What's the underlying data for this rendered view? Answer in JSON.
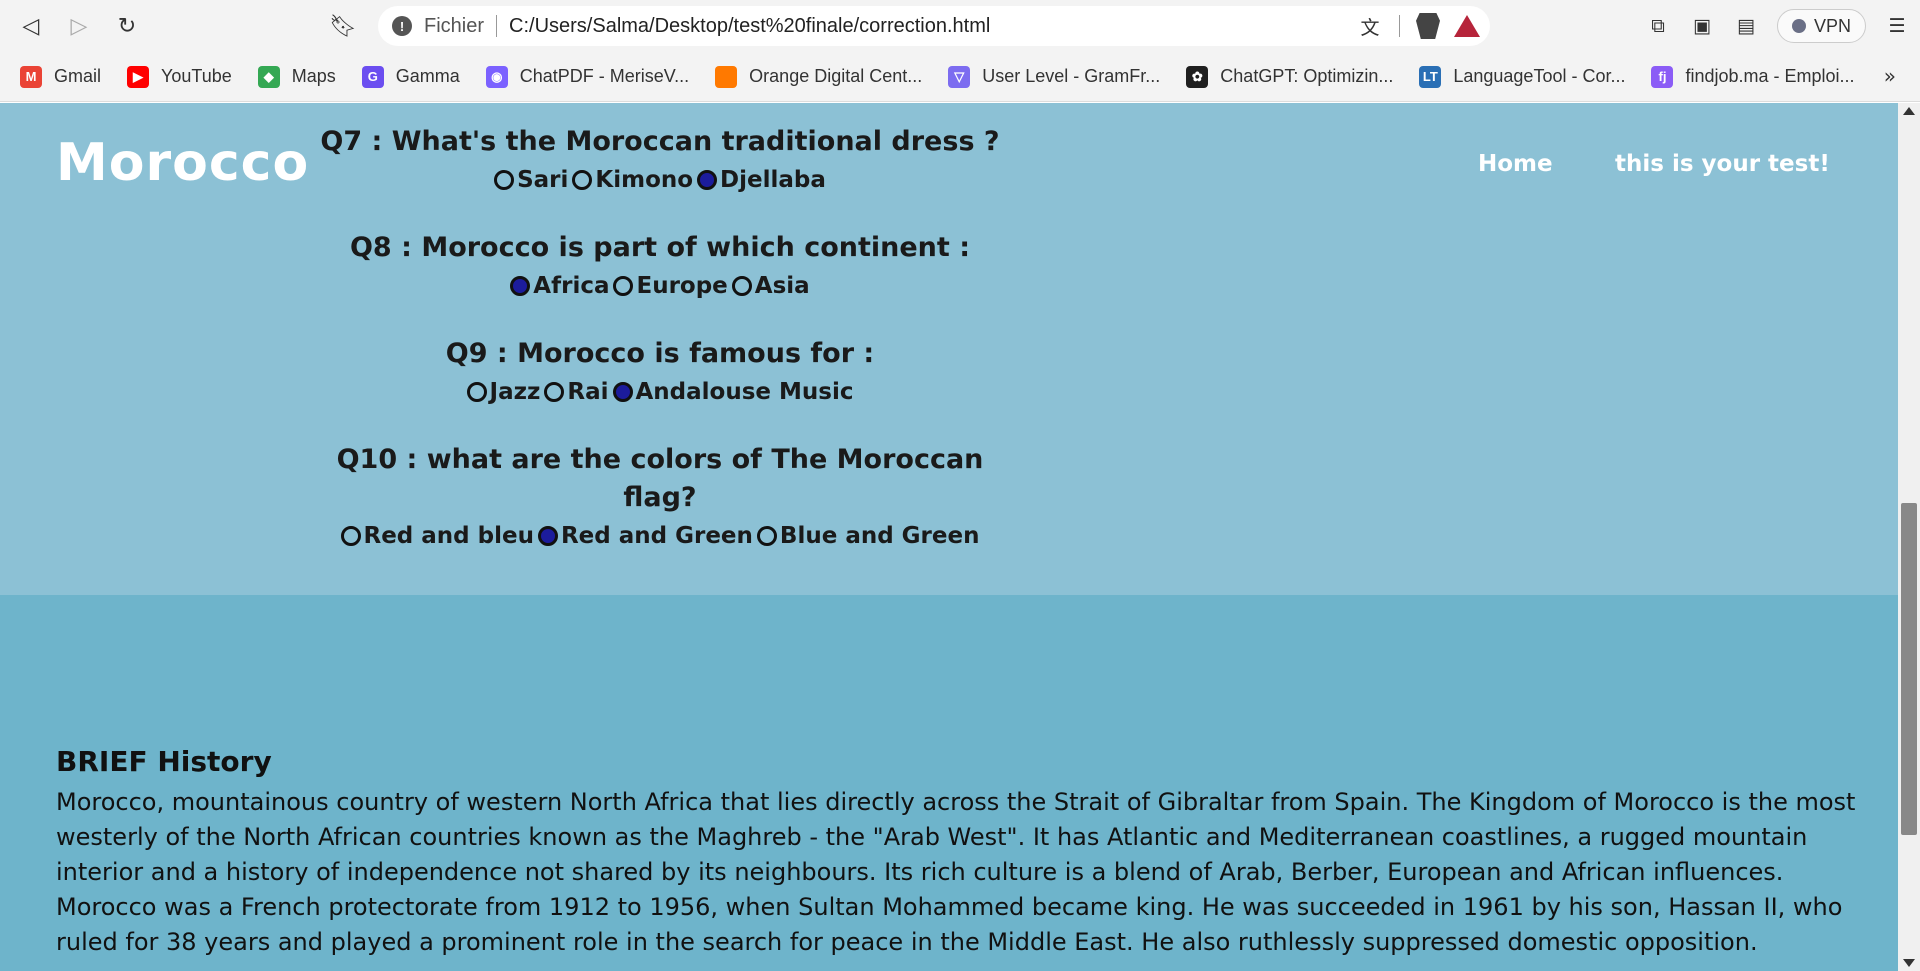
{
  "browser": {
    "url_scheme": "Fichier",
    "url": "C:/Users/Salma/Desktop/test%20finale/correction.html",
    "vpn_label": "VPN",
    "bookmarks": [
      {
        "label": "Gmail",
        "icon": "gmail-icon",
        "color": "#ea4335",
        "glyph": "M"
      },
      {
        "label": "YouTube",
        "icon": "youtube-icon",
        "color": "#ff0000",
        "glyph": "▶"
      },
      {
        "label": "Maps",
        "icon": "maps-icon",
        "color": "#34a853",
        "glyph": "◆"
      },
      {
        "label": "Gamma",
        "icon": "gamma-icon",
        "color": "#6b4ef0",
        "glyph": "G"
      },
      {
        "label": "ChatPDF - MeriseV...",
        "icon": "chatpdf-icon",
        "color": "#7b61ff",
        "glyph": "◉"
      },
      {
        "label": "Orange Digital Cent...",
        "icon": "orange-icon",
        "color": "#ff7900",
        "glyph": ""
      },
      {
        "label": "User Level - GramFr...",
        "icon": "gramfree-icon",
        "color": "#7c6cf0",
        "glyph": "▽"
      },
      {
        "label": "ChatGPT: Optimizin...",
        "icon": "chatgpt-icon",
        "color": "#1f1f1f",
        "glyph": "✿"
      },
      {
        "label": "LanguageTool - Cor...",
        "icon": "languagetool-icon",
        "color": "#2a6fb5",
        "glyph": "LT"
      },
      {
        "label": "findjob.ma - Emploi...",
        "icon": "findjob-icon",
        "color": "#8b5cf6",
        "glyph": "fj"
      }
    ],
    "more": "»"
  },
  "page": {
    "logo": "Morocco",
    "nav": {
      "home": "Home",
      "test": "this is your test!"
    },
    "questions": [
      {
        "text": "Q7 : What's the Moroccan traditional dress ?",
        "options": [
          {
            "label": "Sari",
            "checked": false
          },
          {
            "label": "Kimono",
            "checked": false
          },
          {
            "label": "Djellaba",
            "checked": true
          }
        ]
      },
      {
        "text": "Q8 : Morocco is part of which continent :",
        "options": [
          {
            "label": "Africa",
            "checked": true
          },
          {
            "label": "Europe",
            "checked": false
          },
          {
            "label": "Asia",
            "checked": false
          }
        ]
      },
      {
        "text": "Q9 : Morocco is famous for :",
        "options": [
          {
            "label": "Jazz",
            "checked": false
          },
          {
            "label": "Rai",
            "checked": false
          },
          {
            "label": "Andalouse Music",
            "checked": true
          }
        ]
      },
      {
        "text": "Q10 : what are the colors of The Moroccan flag?",
        "options": [
          {
            "label": "Red and bleu",
            "checked": false
          },
          {
            "label": "Red and Green",
            "checked": true
          },
          {
            "label": "Blue and Green",
            "checked": false
          }
        ]
      }
    ],
    "history_title": "BRIEF History",
    "history_text": "Morocco, mountainous country of western North Africa that lies directly across the Strait of Gibraltar from Spain. The Kingdom of Morocco is the most westerly of the North African countries known as the Maghreb - the \"Arab West\". It has Atlantic and Mediterranean coastlines, a rugged mountain interior and a history of independence not shared by its neighbours. Its rich culture is a blend of Arab, Berber, European and African influences. Morocco was a French protectorate from 1912 to 1956, when Sultan Mohammed became king. He was succeeded in 1961 by his son, Hassan II, who ruled for 38 years and played a prominent role in the search for peace in the Middle East. He also ruthlessly suppressed domestic opposition."
  },
  "colors": {
    "hero_bg": "#8cc1d5",
    "history_bg": "#6eb4cb",
    "radio_checked": "#1c1c9c"
  }
}
